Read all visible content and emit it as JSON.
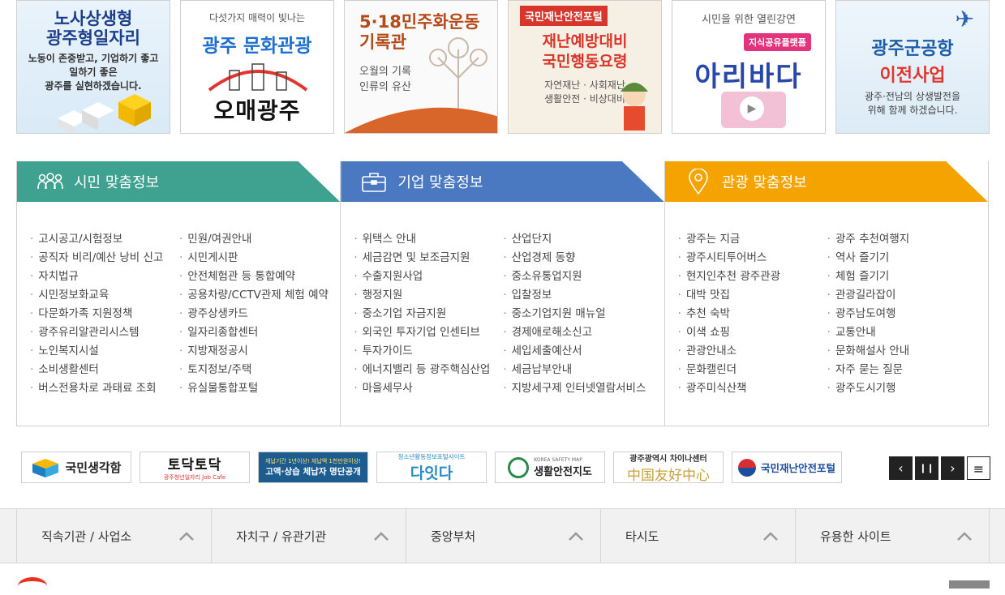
{
  "banners": [
    {
      "title1": "노사상생형",
      "title2": "광주형일자리",
      "line1": "노동이 존중받고, 기업하기 좋고",
      "line2": "일하기 좋은",
      "line3": "광주를 실현하겠습니다."
    },
    {
      "subtitle": "다섯가지 매력이 빛나는",
      "title": "광주 문화관광",
      "brand": "오매광주"
    },
    {
      "title1": "5·18민주화운동",
      "title2": "기록관",
      "line1": "오월의 기록",
      "line2": "인류의 유산"
    },
    {
      "tag": "국민재난안전포털",
      "title1": "재난예방대비",
      "title2": "국민행동요령",
      "line1": "자연재난 · 사회재난",
      "line2": "생활안전 · 비상대비"
    },
    {
      "subtitle": "시민을 위한 열린강연",
      "tag": "지식공유플랫폼",
      "title": "아리바다"
    },
    {
      "title1": "광주군공항",
      "title2": "이전사업",
      "line1": "광주·전남의 상생발전을",
      "line2": "위해 함께 하겠습니다."
    }
  ],
  "panels": {
    "citizen": {
      "title": "시민 맞춤정보",
      "col1": [
        "고시공고/시험정보",
        "공직자 비리/예산 낭비 신고",
        "자치법규",
        "시민정보화교육",
        "다문화가족 지원정책",
        "광주유리알관리시스템",
        "노인복지시설",
        "소비생활센터",
        "버스전용차로 과태료 조회"
      ],
      "col2": [
        "민원/여권안내",
        "시민게시판",
        "안전체험관 등 통합예약",
        "공용차량/CCTV관제 체험 예약",
        "광주상생카드",
        "일자리종합센터",
        "지방재정공시",
        "토지정보/주택",
        "유실물통합포털"
      ]
    },
    "business": {
      "title": "기업 맞춤정보",
      "col1": [
        "위택스 안내",
        "세금감면 및 보조금지원",
        "수출지원사업",
        "행정지원",
        "중소기업 자금지원",
        "외국인 투자기업 인센티브",
        "투자가이드",
        "에너지밸리 등 광주핵심산업",
        "마을세무사"
      ],
      "col2": [
        "산업단지",
        "산업경제 동향",
        "중소유통업지원",
        "입찰정보",
        "중소기업지원 매뉴얼",
        "경제애로해소신고",
        "세입세출예산서",
        "세금납부안내",
        "지방세구제 인터넷열람서비스"
      ]
    },
    "tourism": {
      "title": "관광 맞춤정보",
      "col1": [
        "광주는 지금",
        "광주시티투어버스",
        "현지인추천 광주관광",
        "대박 맛집",
        "추천 숙박",
        "이색 쇼핑",
        "관광안내소",
        "문화캘린더",
        "광주미식산책"
      ],
      "col2": [
        "광주 추천여행지",
        "역사 즐기기",
        "체험 즐기기",
        "관광길라잡이",
        "광주남도여행",
        "교통안내",
        "문화해설사 안내",
        "자주 묻는 질문",
        "광주도시기행"
      ]
    }
  },
  "logos": [
    {
      "label": "국민생각함"
    },
    {
      "label": "토닥토닥",
      "sub": "광주청년일자리 Job Cafe"
    },
    {
      "label": "고액·상습 체납자 명단공개",
      "sub": "체납기간 1년이상! 체납액 1천만원이상!"
    },
    {
      "label": "다잇다",
      "sub": "청소년활동정보포털사이트"
    },
    {
      "label": "생활안전지도",
      "sub": "KOREA SAFETY MAP"
    },
    {
      "label": "中国友好中心",
      "sub": "광주광역시 차이나센터"
    },
    {
      "label": "국민재난안전포털"
    }
  ],
  "controls": {
    "prev": "‹",
    "pause": "❙❙",
    "next": "›",
    "menu": "≡"
  },
  "footer": [
    "직속기관 / 사업소",
    "자치구 / 유관기관",
    "중앙부처",
    "타시도",
    "유용한 사이트"
  ],
  "colors": {
    "citizen": "#3fa18f",
    "business": "#4a79c1",
    "tourism": "#f5a300"
  }
}
